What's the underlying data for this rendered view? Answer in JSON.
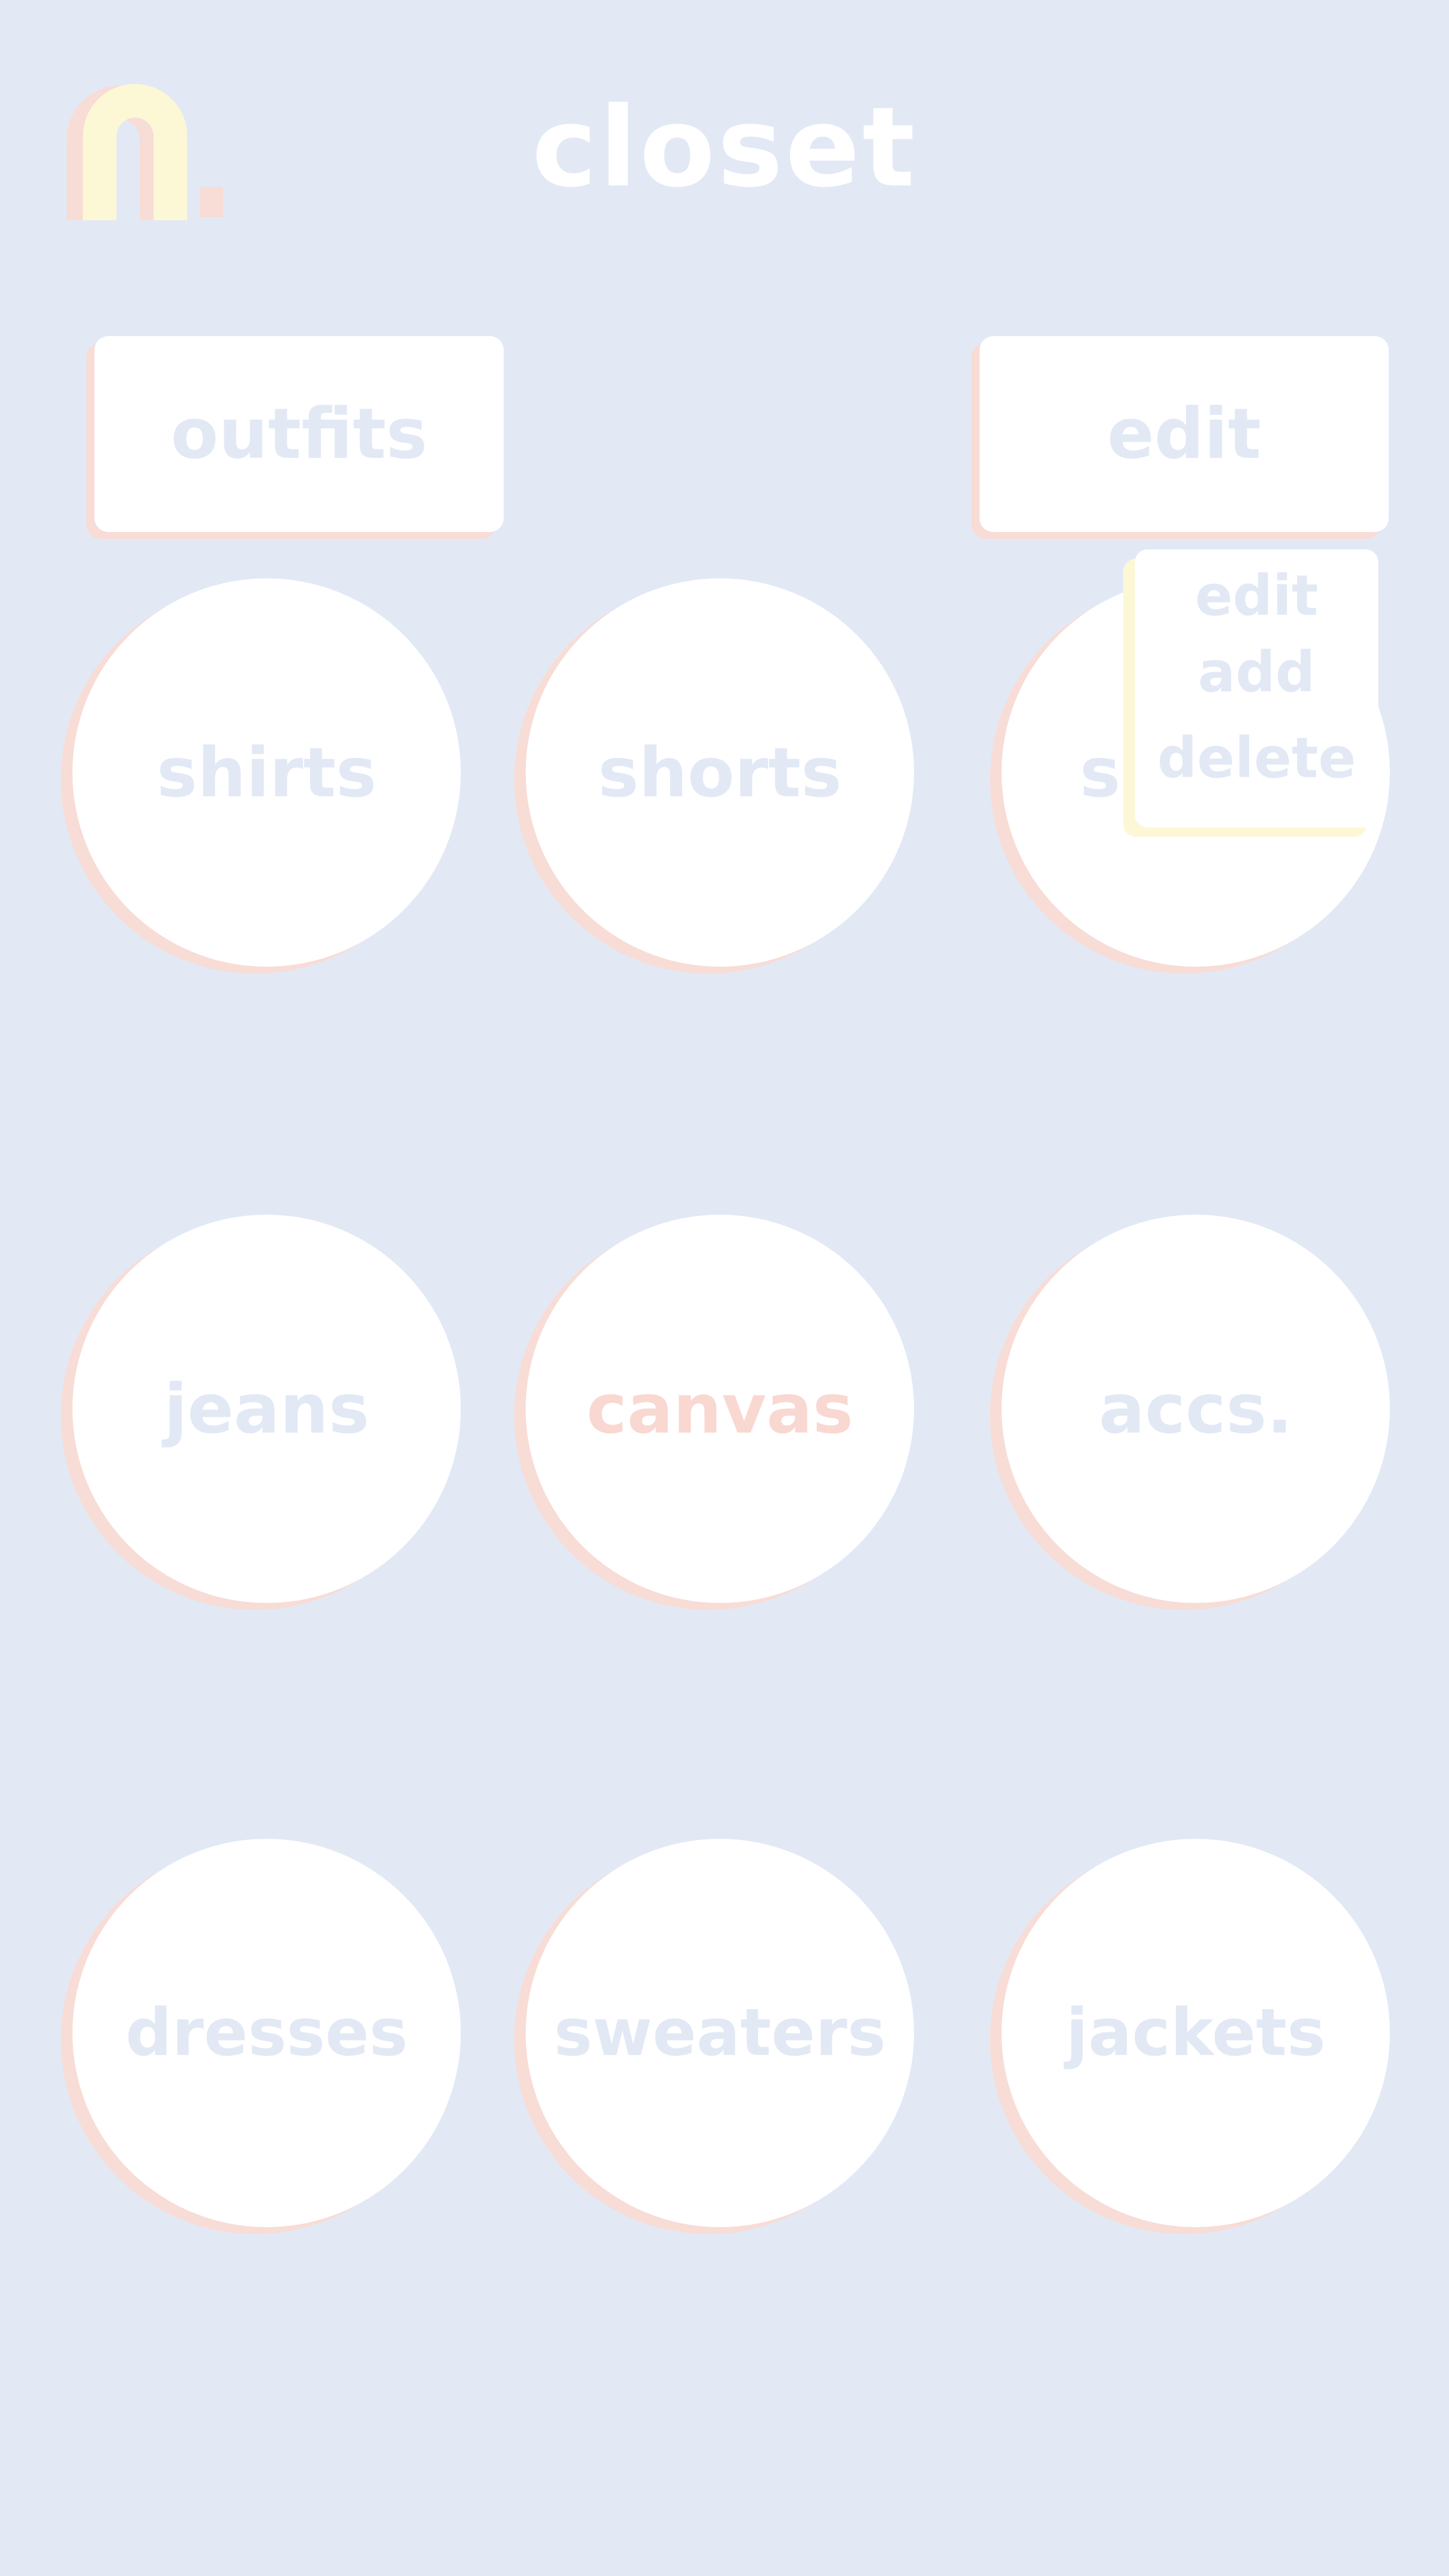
{
  "header": {
    "title": "closet",
    "logo_icon": "arch-logo-icon"
  },
  "nav": {
    "outfits_label": "outfits",
    "edit_label": "edit"
  },
  "edit_menu": {
    "items": [
      "edit",
      "add",
      "delete"
    ]
  },
  "categories": [
    "shirts",
    "shorts",
    "s",
    "jeans",
    "canvas",
    "accs.",
    "dresses",
    "sweaters",
    "jackets"
  ],
  "colors": {
    "background": "#e2e9f5",
    "card": "#ffffff",
    "shadow_pink": "#f8dcd6",
    "accent_yellow": "#fcf8d6"
  }
}
